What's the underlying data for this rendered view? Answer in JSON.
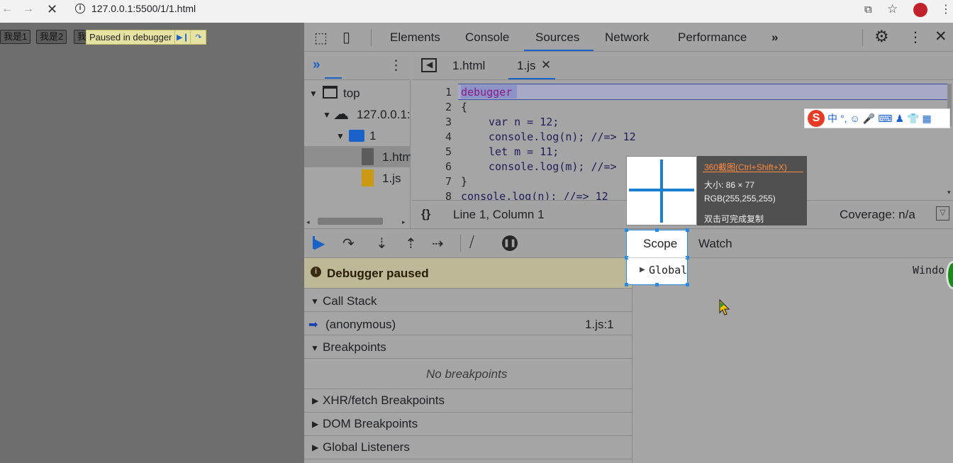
{
  "browser": {
    "url": "127.0.0.1:5500/1/1.html"
  },
  "page": {
    "buttons": [
      "我是1",
      "我是2",
      "我"
    ],
    "paused_banner": "Paused in debugger"
  },
  "devtools": {
    "tabs": [
      "Elements",
      "Console",
      "Sources",
      "Network",
      "Performance"
    ],
    "active_tab": "Sources",
    "more_tabs": "»",
    "navigator": {
      "more": "»",
      "tree": [
        {
          "label": "top"
        },
        {
          "label": "127.0.0.1:5"
        },
        {
          "label": "1"
        },
        {
          "label": "1.htm"
        },
        {
          "label": "1.js"
        }
      ]
    },
    "editor_tabs": [
      "1.html",
      "1.js"
    ],
    "active_editor_tab": "1.js",
    "code_lines": [
      {
        "n": "1",
        "text": "debugger"
      },
      {
        "n": "2",
        "text": "{"
      },
      {
        "n": "3",
        "text": "var n = 12;"
      },
      {
        "n": "4",
        "text": "console.log(n); //=> 12"
      },
      {
        "n": "5",
        "text": "let m = 11;"
      },
      {
        "n": "6",
        "text": "console.log(m); //=>"
      },
      {
        "n": "7",
        "text": "}"
      },
      {
        "n": "8",
        "text": "console.log(n); //=> 12"
      }
    ],
    "status": {
      "format": "{}",
      "position": "Line 1, Column 1",
      "coverage": "Coverage: n/a"
    },
    "debugger_paused": "Debugger paused",
    "sections": {
      "call_stack": "Call Stack",
      "call_frame": "(anonymous)",
      "call_location": "1.js:1",
      "breakpoints": "Breakpoints",
      "no_breakpoints": "No breakpoints",
      "xhr": "XHR/fetch Breakpoints",
      "dom": "DOM Breakpoints",
      "global": "Global Listeners"
    },
    "scope_tabs": [
      "Scope",
      "Watch"
    ],
    "scope_global": "Global",
    "scope_global_value": "Windo"
  },
  "ime": {
    "logo": "S",
    "zh": "中"
  },
  "screenshot_tool": {
    "title": "360截图(Ctrl+Shift+X)",
    "size": "大小: 86 × 77",
    "rgb": "RGB(255,255,255)",
    "hint": "双击可完成复制"
  },
  "colors": {
    "accent": "#1a62c9",
    "paused_banner": "#e6e2a4",
    "debugger_paused_bg": "#bdb895"
  }
}
